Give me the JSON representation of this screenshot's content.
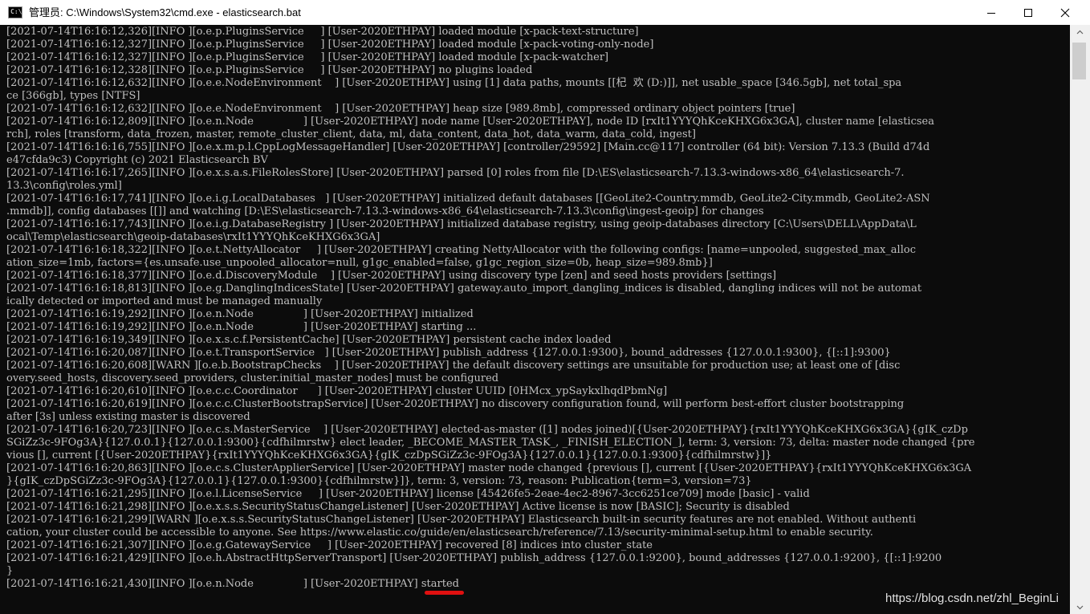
{
  "window": {
    "title": "管理员: C:\\Windows\\System32\\cmd.exe - elasticsearch.bat",
    "app_icon_text": "C:\\",
    "controls": [
      "minimize",
      "maximize",
      "close"
    ]
  },
  "console": {
    "lines": [
      "[2021-07-14T16:16:12,326][INFO ][o.e.p.PluginsService     ] [User-2020ETHPAY] loaded module [x-pack-text-structure]",
      "[2021-07-14T16:16:12,327][INFO ][o.e.p.PluginsService     ] [User-2020ETHPAY] loaded module [x-pack-voting-only-node]",
      "[2021-07-14T16:16:12,327][INFO ][o.e.p.PluginsService     ] [User-2020ETHPAY] loaded module [x-pack-watcher]",
      "[2021-07-14T16:16:12,328][INFO ][o.e.p.PluginsService     ] [User-2020ETHPAY] no plugins loaded",
      "[2021-07-14T16:16:12,632][INFO ][o.e.e.NodeEnvironment    ] [User-2020ETHPAY] using [1] data paths, mounts [[杞  欢 (D:)]], net usable_space [346.5gb], net total_spa",
      "ce [366gb], types [NTFS]",
      "[2021-07-14T16:16:12,632][INFO ][o.e.e.NodeEnvironment    ] [User-2020ETHPAY] heap size [989.8mb], compressed ordinary object pointers [true]",
      "[2021-07-14T16:16:12,809][INFO ][o.e.n.Node               ] [User-2020ETHPAY] node name [User-2020ETHPAY], node ID [rxIt1YYYQhKceKHXG6x3GA], cluster name [elasticsea",
      "rch], roles [transform, data_frozen, master, remote_cluster_client, data, ml, data_content, data_hot, data_warm, data_cold, ingest]",
      "[2021-07-14T16:16:16,755][INFO ][o.e.x.m.p.l.CppLogMessageHandler] [User-2020ETHPAY] [controller/29592] [Main.cc@117] controller (64 bit): Version 7.13.3 (Build d74d",
      "e47cfda9c3) Copyright (c) 2021 Elasticsearch BV",
      "[2021-07-14T16:16:17,265][INFO ][o.e.x.s.a.s.FileRolesStore] [User-2020ETHPAY] parsed [0] roles from file [D:\\ES\\elasticsearch-7.13.3-windows-x86_64\\elasticsearch-7.",
      "13.3\\config\\roles.yml]",
      "[2021-07-14T16:16:17,741][INFO ][o.e.i.g.LocalDatabases   ] [User-2020ETHPAY] initialized default databases [[GeoLite2-Country.mmdb, GeoLite2-City.mmdb, GeoLite2-ASN",
      ".mmdb]], config databases [[]] and watching [D:\\ES\\elasticsearch-7.13.3-windows-x86_64\\elasticsearch-7.13.3\\config\\ingest-geoip] for changes",
      "[2021-07-14T16:16:17,743][INFO ][o.e.i.g.DatabaseRegistry ] [User-2020ETHPAY] initialized database registry, using geoip-databases directory [C:\\Users\\DELL\\AppData\\L",
      "ocal\\Temp\\elasticsearch\\geoip-databases\\rxIt1YYYQhKceKHXG6x3GA]",
      "[2021-07-14T16:16:18,322][INFO ][o.e.t.NettyAllocator     ] [User-2020ETHPAY] creating NettyAllocator with the following configs: [name=unpooled, suggested_max_alloc",
      "ation_size=1mb, factors={es.unsafe.use_unpooled_allocator=null, g1gc_enabled=false, g1gc_region_size=0b, heap_size=989.8mb}]",
      "[2021-07-14T16:16:18,377][INFO ][o.e.d.DiscoveryModule    ] [User-2020ETHPAY] using discovery type [zen] and seed hosts providers [settings]",
      "[2021-07-14T16:16:18,813][INFO ][o.e.g.DanglingIndicesState] [User-2020ETHPAY] gateway.auto_import_dangling_indices is disabled, dangling indices will not be automat",
      "ically detected or imported and must be managed manually",
      "[2021-07-14T16:16:19,292][INFO ][o.e.n.Node               ] [User-2020ETHPAY] initialized",
      "[2021-07-14T16:16:19,292][INFO ][o.e.n.Node               ] [User-2020ETHPAY] starting ...",
      "[2021-07-14T16:16:19,349][INFO ][o.e.x.s.c.f.PersistentCache] [User-2020ETHPAY] persistent cache index loaded",
      "[2021-07-14T16:16:20,087][INFO ][o.e.t.TransportService   ] [User-2020ETHPAY] publish_address {127.0.0.1:9300}, bound_addresses {127.0.0.1:9300}, {[::1]:9300}",
      "[2021-07-14T16:16:20,608][WARN ][o.e.b.BootstrapChecks    ] [User-2020ETHPAY] the default discovery settings are unsuitable for production use; at least one of [disc",
      "overy.seed_hosts, discovery.seed_providers, cluster.initial_master_nodes] must be configured",
      "[2021-07-14T16:16:20,610][INFO ][o.e.c.c.Coordinator      ] [User-2020ETHPAY] cluster UUID [0HMcx_ypSaykxlhqdPbmNg]",
      "[2021-07-14T16:16:20,619][INFO ][o.e.c.c.ClusterBootstrapService] [User-2020ETHPAY] no discovery configuration found, will perform best-effort cluster bootstrapping",
      "after [3s] unless existing master is discovered",
      "[2021-07-14T16:16:20,723][INFO ][o.e.c.s.MasterService    ] [User-2020ETHPAY] elected-as-master ([1] nodes joined)[{User-2020ETHPAY}{rxIt1YYYQhKceKHXG6x3GA}{gIK_czDp",
      "SGiZz3c-9FOg3A}{127.0.0.1}{127.0.0.1:9300}{cdfhilmrstw} elect leader, _BECOME_MASTER_TASK_, _FINISH_ELECTION_], term: 3, version: 73, delta: master node changed {pre",
      "vious [], current [{User-2020ETHPAY}{rxIt1YYYQhKceKHXG6x3GA}{gIK_czDpSGiZz3c-9FOg3A}{127.0.0.1}{127.0.0.1:9300}{cdfhilmrstw}]}",
      "[2021-07-14T16:16:20,863][INFO ][o.e.c.s.ClusterApplierService] [User-2020ETHPAY] master node changed {previous [], current [{User-2020ETHPAY}{rxIt1YYYQhKceKHXG6x3GA",
      "}{gIK_czDpSGiZz3c-9FOg3A}{127.0.0.1}{127.0.0.1:9300}{cdfhilmrstw}]}, term: 3, version: 73, reason: Publication{term=3, version=73}",
      "[2021-07-14T16:16:21,295][INFO ][o.e.l.LicenseService     ] [User-2020ETHPAY] license [45426fe5-2eae-4ec2-8967-3cc6251ce709] mode [basic] - valid",
      "[2021-07-14T16:16:21,298][INFO ][o.e.x.s.s.SecurityStatusChangeListener] [User-2020ETHPAY] Active license is now [BASIC]; Security is disabled",
      "[2021-07-14T16:16:21,299][WARN ][o.e.x.s.s.SecurityStatusChangeListener] [User-2020ETHPAY] Elasticsearch built-in security features are not enabled. Without authenti",
      "cation, your cluster could be accessible to anyone. See https://www.elastic.co/guide/en/elasticsearch/reference/7.13/security-minimal-setup.html to enable security.",
      "[2021-07-14T16:16:21,307][INFO ][o.e.g.GatewayService     ] [User-2020ETHPAY] recovered [8] indices into cluster_state",
      "[2021-07-14T16:16:21,429][INFO ][o.e.h.AbstractHttpServerTransport] [User-2020ETHPAY] publish_address {127.0.0.1:9200}, bound_addresses {127.0.0.1:9200}, {[::1]:9200",
      "}"
    ],
    "last_line_prefix": "[2021-07-14T16:16:21,430][INFO ][o.e.n.Node               ] [User-2020ETHPAY] ",
    "last_line_highlight": "started",
    "highlight_color": "#e01010"
  },
  "watermark": "https://blog.csdn.net/zhl_BeginLi"
}
